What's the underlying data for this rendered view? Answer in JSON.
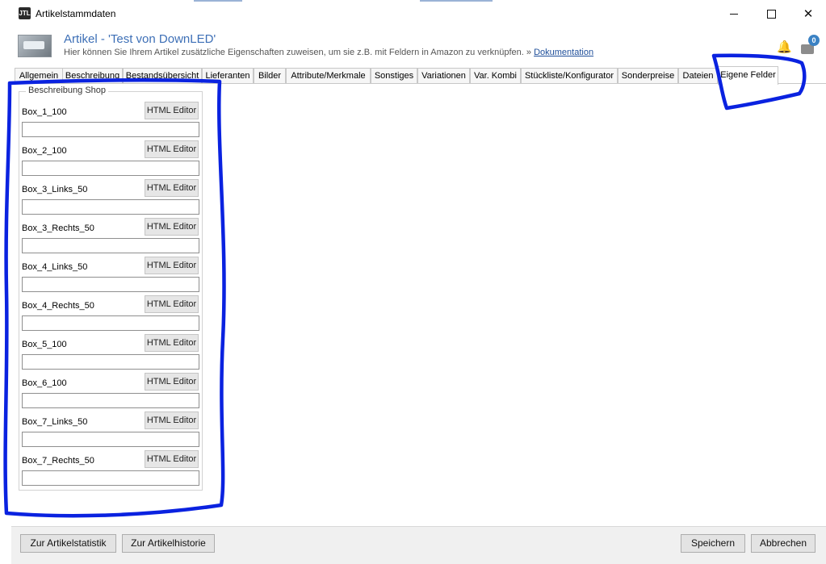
{
  "window": {
    "title": "Artikelstammdaten",
    "app_icon_text": "JTL"
  },
  "header": {
    "article_title": "Artikel - 'Test von DownLED'",
    "subtitle": "Hier können Sie Ihrem Artikel zusätzliche Eigenschaften zuweisen, um sie z.B. mit Feldern in Amazon zu verknüpfen.",
    "doc_prefix": "»",
    "doc_link": "Dokumentation",
    "sync_badge": "0"
  },
  "tabs": [
    {
      "label": "Allgemein",
      "active": false
    },
    {
      "label": "Beschreibung",
      "active": false
    },
    {
      "label": "Bestandsübersicht",
      "active": false
    },
    {
      "label": "Lieferanten",
      "active": false
    },
    {
      "label": "Bilder",
      "active": false
    },
    {
      "label": "Attribute/Merkmale",
      "active": false
    },
    {
      "label": "Sonstiges",
      "active": false
    },
    {
      "label": "Variationen",
      "active": false
    },
    {
      "label": "Var. Kombi",
      "active": false
    },
    {
      "label": "Stückliste/Konfigurator",
      "active": false
    },
    {
      "label": "Sonderpreise",
      "active": false
    },
    {
      "label": "Dateien",
      "active": false
    },
    {
      "label": "Eigene Felder",
      "active": true
    }
  ],
  "group": {
    "legend": "Beschreibung Shop",
    "html_button_label": "HTML Editor",
    "fields": [
      {
        "label": "Box_1_100",
        "value": ""
      },
      {
        "label": "Box_2_100",
        "value": ""
      },
      {
        "label": "Box_3_Links_50",
        "value": ""
      },
      {
        "label": "Box_3_Rechts_50",
        "value": ""
      },
      {
        "label": "Box_4_Links_50",
        "value": ""
      },
      {
        "label": "Box_4_Rechts_50",
        "value": ""
      },
      {
        "label": "Box_5_100",
        "value": ""
      },
      {
        "label": "Box_6_100",
        "value": ""
      },
      {
        "label": "Box_7_Links_50",
        "value": ""
      },
      {
        "label": "Box_7_Rechts_50",
        "value": ""
      }
    ]
  },
  "footer": {
    "stats_label": "Zur Artikelstatistik",
    "history_label": "Zur Artikelhistorie",
    "save_label": "Speichern",
    "cancel_label": "Abbrechen"
  },
  "colors": {
    "accent_title": "#3d6fb6",
    "link": "#1f4f9a",
    "annotation_marker": "#0a22e0"
  }
}
